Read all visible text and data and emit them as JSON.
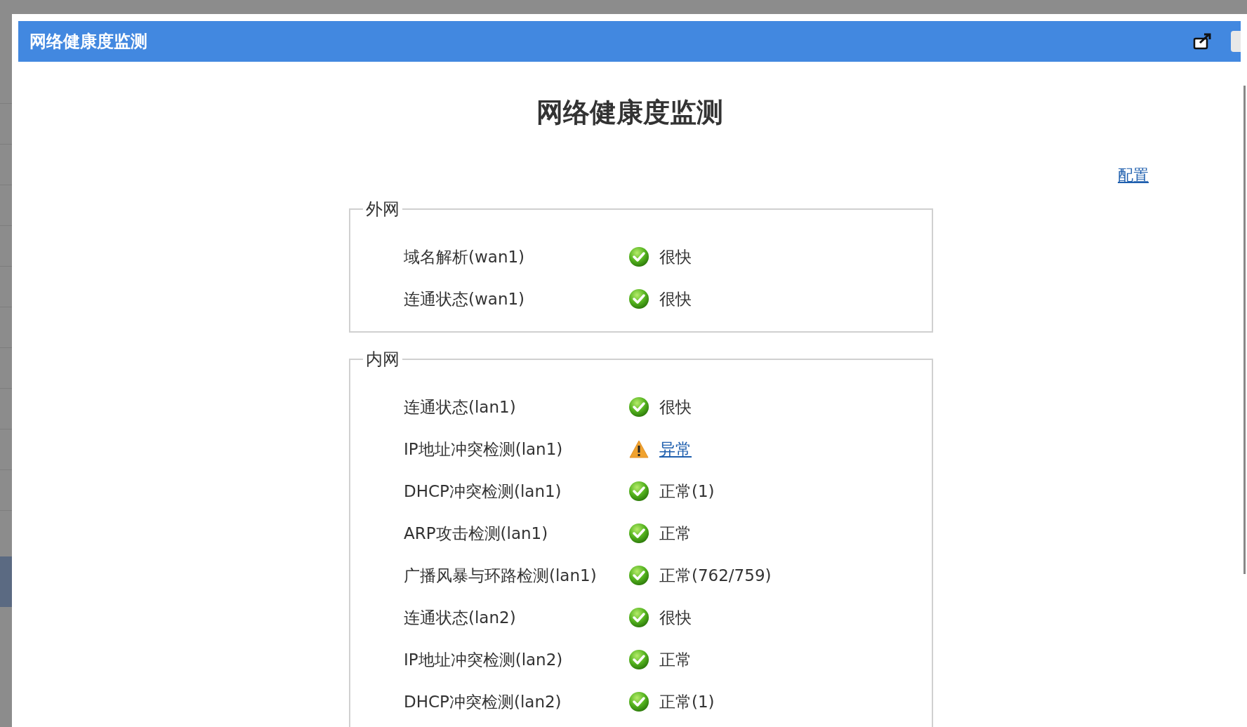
{
  "dialog": {
    "title": "网络健康度监测"
  },
  "page": {
    "heading": "网络健康度监测",
    "config_link": "配置"
  },
  "groups": [
    {
      "legend": "外网",
      "rows": [
        {
          "label": "域名解析(wan1)",
          "kind": "ok",
          "value": "很快",
          "link": false
        },
        {
          "label": "连通状态(wan1)",
          "kind": "ok",
          "value": "很快",
          "link": false
        }
      ]
    },
    {
      "legend": "内网",
      "rows": [
        {
          "label": "连通状态(lan1)",
          "kind": "ok",
          "value": "很快",
          "link": false
        },
        {
          "label": "IP地址冲突检测(lan1)",
          "kind": "warning",
          "value": "异常",
          "link": true
        },
        {
          "label": "DHCP冲突检测(lan1)",
          "kind": "ok",
          "value": "正常(1)",
          "link": false
        },
        {
          "label": "ARP攻击检测(lan1)",
          "kind": "ok",
          "value": "正常",
          "link": false
        },
        {
          "label": "广播风暴与环路检测(lan1)",
          "kind": "ok",
          "value": "正常(762/759)",
          "link": false
        },
        {
          "label": "连通状态(lan2)",
          "kind": "ok",
          "value": "很快",
          "link": false
        },
        {
          "label": "IP地址冲突检测(lan2)",
          "kind": "ok",
          "value": "正常",
          "link": false
        },
        {
          "label": "DHCP冲突检测(lan2)",
          "kind": "ok",
          "value": "正常(1)",
          "link": false
        }
      ]
    }
  ]
}
